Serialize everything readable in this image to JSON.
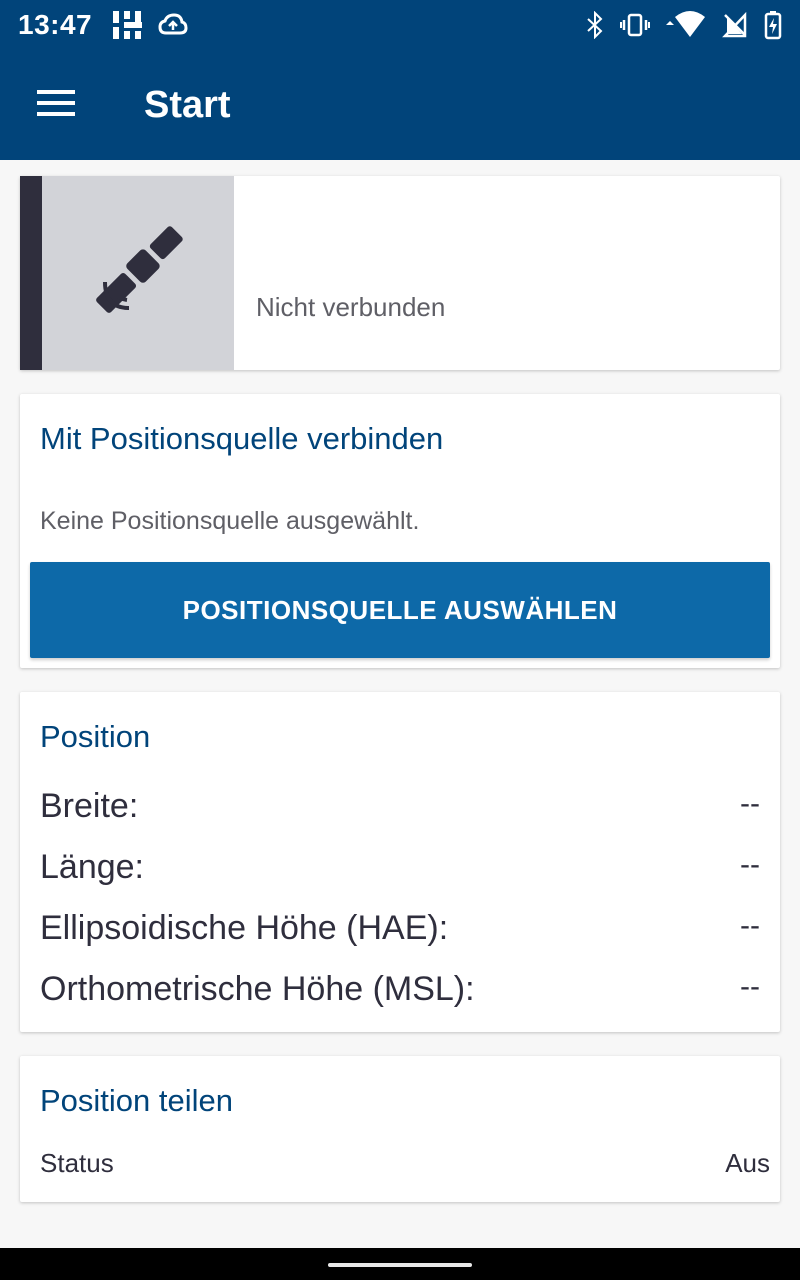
{
  "status_bar": {
    "time": "13:47",
    "icons_left": [
      "grid-notification-icon",
      "cloud-sync-icon"
    ],
    "icons_right": [
      "bluetooth-icon",
      "vibrate-icon",
      "wifi-icon",
      "no-sim-icon",
      "battery-charging-icon"
    ]
  },
  "app_bar": {
    "title": "Start",
    "menu_icon": "hamburger-menu-icon"
  },
  "connection": {
    "status_text": "Nicht verbunden",
    "icon": "satellite-icon"
  },
  "source": {
    "title": "Mit Positionsquelle verbinden",
    "note": "Keine Positionsquelle ausgewählt.",
    "button_label": "POSITIONSQUELLE AUSWÄHLEN"
  },
  "position": {
    "title": "Position",
    "rows": [
      {
        "label": "Breite:",
        "value": "--"
      },
      {
        "label": "Länge:",
        "value": "--"
      },
      {
        "label": "Ellipsoidische Höhe (HAE):",
        "value": "--"
      },
      {
        "label": "Orthometrische Höhe (MSL):",
        "value": "--"
      }
    ]
  },
  "share": {
    "title": "Position teilen",
    "status_label": "Status",
    "status_value": "Aus"
  },
  "colors": {
    "primary": "#01447a",
    "button": "#0d69a8",
    "stripe": "#2f2e3d",
    "icon_box": "#d2d3d8"
  }
}
